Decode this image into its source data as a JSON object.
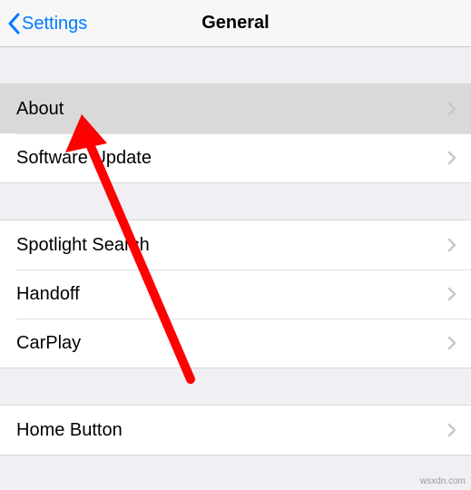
{
  "nav": {
    "back_label": "Settings",
    "title": "General"
  },
  "groups": [
    {
      "rows": [
        {
          "label": "About",
          "pressed": true
        },
        {
          "label": "Software Update"
        }
      ]
    },
    {
      "rows": [
        {
          "label": "Spotlight Search"
        },
        {
          "label": "Handoff"
        },
        {
          "label": "CarPlay"
        }
      ]
    },
    {
      "rows": [
        {
          "label": "Home Button"
        }
      ]
    }
  ],
  "watermark": "wsxdn.com"
}
